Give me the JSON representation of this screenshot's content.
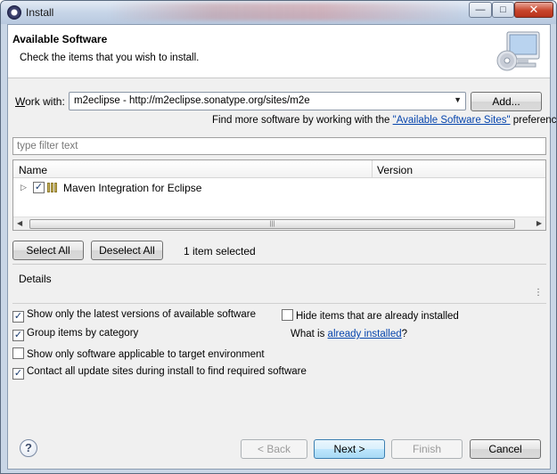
{
  "window": {
    "title": "Install",
    "minimize_glyph": "—",
    "maximize_glyph": "□",
    "close_glyph": "✕"
  },
  "header": {
    "title": "Available Software",
    "subtitle": "Check the items that you wish to install."
  },
  "work_with": {
    "label_mnemonic": "W",
    "label_rest": "ork with:",
    "value": "m2eclipse - http://m2eclipse.sonatype.org/sites/m2e",
    "add_button": "Add..."
  },
  "find_more": {
    "prefix": "Find more software by working with the ",
    "link": "\"Available Software Sites\"",
    "suffix": " preferences."
  },
  "filter": {
    "placeholder": "type filter text"
  },
  "tree": {
    "columns": [
      "Name",
      "Version"
    ],
    "rows": [
      {
        "label": "Maven Integration for Eclipse",
        "version": "",
        "checked": true
      }
    ]
  },
  "buttons": {
    "select_all": "Select All",
    "deselect_all": "Deselect All"
  },
  "selection_status": "1 item selected",
  "details_label": "Details",
  "options": {
    "show_latest": {
      "label": "Show only the latest versions of available software",
      "checked": true
    },
    "hide_installed": {
      "label": "Hide items that are already installed",
      "checked": false
    },
    "group_by_category": {
      "label": "Group items by category",
      "checked": true
    },
    "what_is_prefix": "What is ",
    "what_is_link": "already installed",
    "what_is_suffix": "?",
    "show_applicable": {
      "label": "Show only software applicable to target environment",
      "checked": false
    },
    "contact_sites": {
      "label": "Contact all update sites during install to find required software",
      "checked": true
    }
  },
  "footer": {
    "help_glyph": "?",
    "back": "< Back",
    "next": "Next >",
    "finish": "Finish",
    "cancel": "Cancel"
  },
  "icons": {
    "app": "eclipse-icon",
    "header": "monitor-cd-icon",
    "help": "help-icon",
    "dropdown": "chevron-down-icon",
    "expand": "triangle-right-icon",
    "package": "feature-package-icon"
  }
}
